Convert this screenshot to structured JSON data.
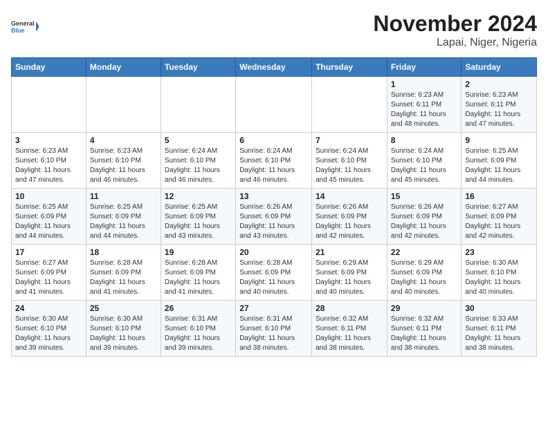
{
  "logo": {
    "line1": "General",
    "line2": "Blue"
  },
  "title": "November 2024",
  "subtitle": "Lapai, Niger, Nigeria",
  "weekdays": [
    "Sunday",
    "Monday",
    "Tuesday",
    "Wednesday",
    "Thursday",
    "Friday",
    "Saturday"
  ],
  "weeks": [
    [
      {
        "day": "",
        "info": ""
      },
      {
        "day": "",
        "info": ""
      },
      {
        "day": "",
        "info": ""
      },
      {
        "day": "",
        "info": ""
      },
      {
        "day": "",
        "info": ""
      },
      {
        "day": "1",
        "info": "Sunrise: 6:23 AM\nSunset: 6:11 PM\nDaylight: 11 hours\nand 48 minutes."
      },
      {
        "day": "2",
        "info": "Sunrise: 6:23 AM\nSunset: 6:11 PM\nDaylight: 11 hours\nand 47 minutes."
      }
    ],
    [
      {
        "day": "3",
        "info": "Sunrise: 6:23 AM\nSunset: 6:10 PM\nDaylight: 11 hours\nand 47 minutes."
      },
      {
        "day": "4",
        "info": "Sunrise: 6:23 AM\nSunset: 6:10 PM\nDaylight: 11 hours\nand 46 minutes."
      },
      {
        "day": "5",
        "info": "Sunrise: 6:24 AM\nSunset: 6:10 PM\nDaylight: 11 hours\nand 46 minutes."
      },
      {
        "day": "6",
        "info": "Sunrise: 6:24 AM\nSunset: 6:10 PM\nDaylight: 11 hours\nand 46 minutes."
      },
      {
        "day": "7",
        "info": "Sunrise: 6:24 AM\nSunset: 6:10 PM\nDaylight: 11 hours\nand 45 minutes."
      },
      {
        "day": "8",
        "info": "Sunrise: 6:24 AM\nSunset: 6:10 PM\nDaylight: 11 hours\nand 45 minutes."
      },
      {
        "day": "9",
        "info": "Sunrise: 6:25 AM\nSunset: 6:09 PM\nDaylight: 11 hours\nand 44 minutes."
      }
    ],
    [
      {
        "day": "10",
        "info": "Sunrise: 6:25 AM\nSunset: 6:09 PM\nDaylight: 11 hours\nand 44 minutes."
      },
      {
        "day": "11",
        "info": "Sunrise: 6:25 AM\nSunset: 6:09 PM\nDaylight: 11 hours\nand 44 minutes."
      },
      {
        "day": "12",
        "info": "Sunrise: 6:25 AM\nSunset: 6:09 PM\nDaylight: 11 hours\nand 43 minutes."
      },
      {
        "day": "13",
        "info": "Sunrise: 6:26 AM\nSunset: 6:09 PM\nDaylight: 11 hours\nand 43 minutes."
      },
      {
        "day": "14",
        "info": "Sunrise: 6:26 AM\nSunset: 6:09 PM\nDaylight: 11 hours\nand 42 minutes."
      },
      {
        "day": "15",
        "info": "Sunrise: 6:26 AM\nSunset: 6:09 PM\nDaylight: 11 hours\nand 42 minutes."
      },
      {
        "day": "16",
        "info": "Sunrise: 6:27 AM\nSunset: 6:09 PM\nDaylight: 11 hours\nand 42 minutes."
      }
    ],
    [
      {
        "day": "17",
        "info": "Sunrise: 6:27 AM\nSunset: 6:09 PM\nDaylight: 11 hours\nand 41 minutes."
      },
      {
        "day": "18",
        "info": "Sunrise: 6:28 AM\nSunset: 6:09 PM\nDaylight: 11 hours\nand 41 minutes."
      },
      {
        "day": "19",
        "info": "Sunrise: 6:28 AM\nSunset: 6:09 PM\nDaylight: 11 hours\nand 41 minutes."
      },
      {
        "day": "20",
        "info": "Sunrise: 6:28 AM\nSunset: 6:09 PM\nDaylight: 11 hours\nand 40 minutes."
      },
      {
        "day": "21",
        "info": "Sunrise: 6:29 AM\nSunset: 6:09 PM\nDaylight: 11 hours\nand 40 minutes."
      },
      {
        "day": "22",
        "info": "Sunrise: 6:29 AM\nSunset: 6:09 PM\nDaylight: 11 hours\nand 40 minutes."
      },
      {
        "day": "23",
        "info": "Sunrise: 6:30 AM\nSunset: 6:10 PM\nDaylight: 11 hours\nand 40 minutes."
      }
    ],
    [
      {
        "day": "24",
        "info": "Sunrise: 6:30 AM\nSunset: 6:10 PM\nDaylight: 11 hours\nand 39 minutes."
      },
      {
        "day": "25",
        "info": "Sunrise: 6:30 AM\nSunset: 6:10 PM\nDaylight: 11 hours\nand 39 minutes."
      },
      {
        "day": "26",
        "info": "Sunrise: 6:31 AM\nSunset: 6:10 PM\nDaylight: 11 hours\nand 39 minutes."
      },
      {
        "day": "27",
        "info": "Sunrise: 6:31 AM\nSunset: 6:10 PM\nDaylight: 11 hours\nand 38 minutes."
      },
      {
        "day": "28",
        "info": "Sunrise: 6:32 AM\nSunset: 6:11 PM\nDaylight: 11 hours\nand 38 minutes."
      },
      {
        "day": "29",
        "info": "Sunrise: 6:32 AM\nSunset: 6:11 PM\nDaylight: 11 hours\nand 38 minutes."
      },
      {
        "day": "30",
        "info": "Sunrise: 6:33 AM\nSunset: 6:11 PM\nDaylight: 11 hours\nand 38 minutes."
      }
    ]
  ]
}
